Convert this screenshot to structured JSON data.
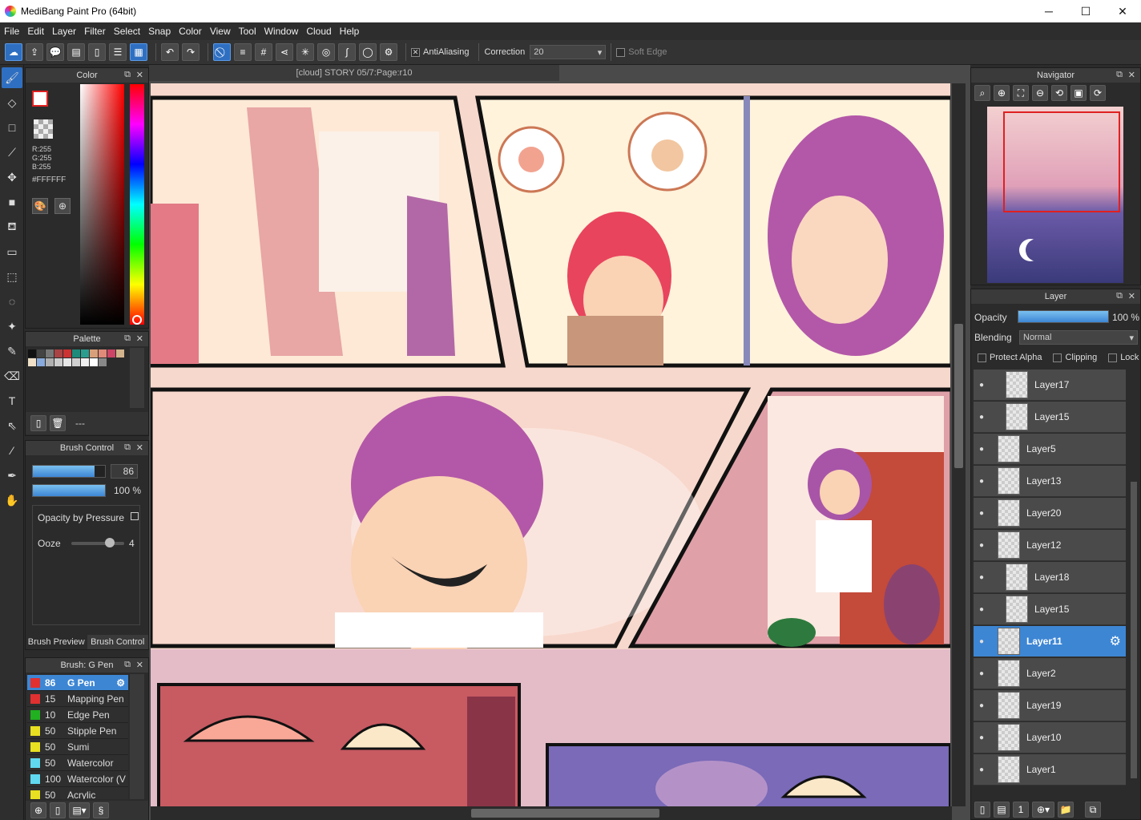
{
  "titlebar": {
    "title": "MediBang Paint Pro (64bit)",
    "minimize": "─",
    "maximize": "☐",
    "close": "✕"
  },
  "menu": [
    "File",
    "Edit",
    "Layer",
    "Filter",
    "Select",
    "Snap",
    "Color",
    "View",
    "Tool",
    "Window",
    "Cloud",
    "Help"
  ],
  "toolbar": {
    "antialiasing_label": "AntiAliasing",
    "antialiasing_checked": "✕",
    "correction_label": "Correction",
    "correction_value": "20",
    "softedge_label": "Soft Edge"
  },
  "document": {
    "tab_title": "[cloud] STORY 05/7:Page:r10"
  },
  "color_panel": {
    "title": "Color",
    "r": "R:255",
    "g": "G:255",
    "b": "B:255",
    "hex": "#FFFFFF",
    "fg_color": "#ffffff",
    "bg_color": "#ffffff"
  },
  "palette_panel": {
    "title": "Palette",
    "footer_text": "---",
    "swatches": [
      "#111111",
      "#444444",
      "#777777",
      "#aa4444",
      "#cc3333",
      "#1e8a7a",
      "#2a9d8f",
      "#d8a07a",
      "#e08a7a",
      "#cc4466",
      "#d2b48c",
      "#f0e0c8",
      "#88aadd",
      "#b0b0b0",
      "#cccccc",
      "#e6e6e6",
      "#d0d0d0",
      "#f0f0f0",
      "#ffffff",
      "#888888"
    ]
  },
  "brush_control": {
    "title": "Brush Control",
    "size_value": "86",
    "size_fraction": 0.86,
    "opacity_value": "100 %",
    "opacity_fraction": 1.0,
    "opacity_pressure_label": "Opacity by Pressure",
    "ooze_label": "Ooze",
    "ooze_value": "4",
    "tab_preview": "Brush Preview",
    "tab_control": "Brush Control"
  },
  "brush_list": {
    "title": "Brush: G Pen",
    "items": [
      {
        "size": "86",
        "name": "G Pen",
        "color": "#e03030"
      },
      {
        "size": "15",
        "name": "Mapping Pen",
        "color": "#e03030"
      },
      {
        "size": "10",
        "name": "Edge Pen",
        "color": "#20b020"
      },
      {
        "size": "50",
        "name": "Stipple Pen",
        "color": "#e8e020"
      },
      {
        "size": "50",
        "name": "Sumi",
        "color": "#e8e020"
      },
      {
        "size": "50",
        "name": "Watercolor",
        "color": "#60d8f0"
      },
      {
        "size": "100",
        "name": "Watercolor (V",
        "color": "#60d8f0"
      },
      {
        "size": "50",
        "name": "Acrylic",
        "color": "#e8e020"
      }
    ]
  },
  "navigator": {
    "title": "Navigator"
  },
  "layer_panel": {
    "title": "Layer",
    "opacity_label": "Opacity",
    "opacity_value": "100 %",
    "opacity_fraction": 1.0,
    "blending_label": "Blending",
    "blending_value": "Normal",
    "protect_alpha": "Protect Alpha",
    "clipping": "Clipping",
    "lock": "Lock",
    "layers": [
      {
        "name": "Layer17",
        "indent": true
      },
      {
        "name": "Layer15",
        "indent": true
      },
      {
        "name": "Layer5",
        "indent": false
      },
      {
        "name": "Layer13",
        "indent": false
      },
      {
        "name": "Layer20",
        "indent": false
      },
      {
        "name": "Layer12",
        "indent": false
      },
      {
        "name": "Layer18",
        "indent": true
      },
      {
        "name": "Layer15",
        "indent": true
      },
      {
        "name": "Layer11",
        "indent": false,
        "selected": true
      },
      {
        "name": "Layer2",
        "indent": false
      },
      {
        "name": "Layer19",
        "indent": false
      },
      {
        "name": "Layer10",
        "indent": false
      },
      {
        "name": "Layer1",
        "indent": false
      }
    ]
  }
}
